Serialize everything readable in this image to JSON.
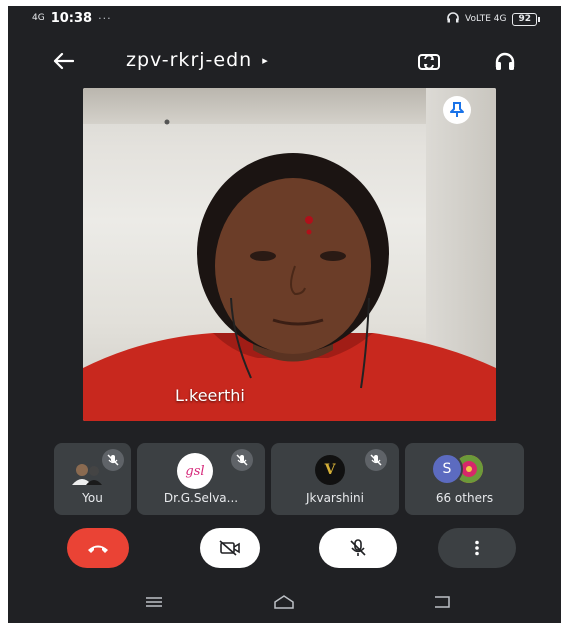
{
  "status_bar": {
    "time": "10:38",
    "dots": "···",
    "network_left": "4G",
    "network_right": "VoLTE 4G",
    "battery": "92"
  },
  "header": {
    "meeting_code": "zpv-rkrj-edn",
    "caret": "▸"
  },
  "main_video": {
    "participant_name": "L.keerthi"
  },
  "participants": [
    {
      "name": "You",
      "muted": true
    },
    {
      "name": "Dr.G.Selva...",
      "muted": true,
      "avatar_text": "gsl"
    },
    {
      "name": "Jkvarshini",
      "muted": true,
      "avatar_text": "V"
    },
    {
      "name": "66 others",
      "avatar_text": "S"
    }
  ],
  "colors": {
    "background": "#202124",
    "tile": "#3c4043",
    "end_call": "#ea4335",
    "control_on": "#ffffff",
    "control_more": "#3c4043"
  }
}
